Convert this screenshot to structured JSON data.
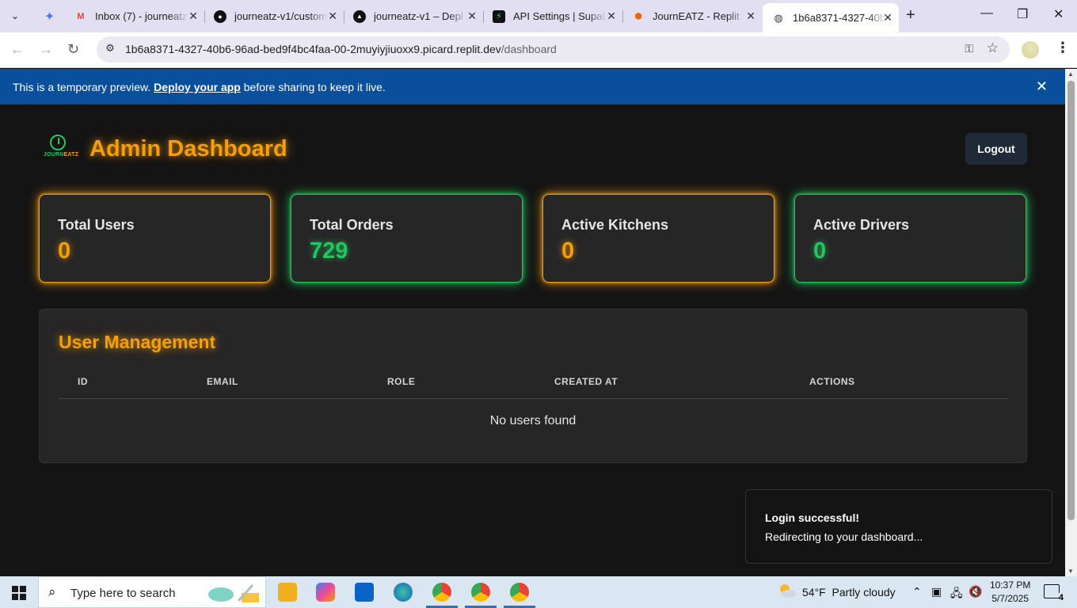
{
  "browser": {
    "tabs": [
      {
        "title": "Inbox (7) - journeatz",
        "favicon": "gmail-icon",
        "active": false
      },
      {
        "title": "journeatz-v1/custom",
        "favicon": "github-icon",
        "active": false
      },
      {
        "title": "journeatz-v1 – Depl",
        "favicon": "vercel-icon",
        "active": false
      },
      {
        "title": "API Settings | Supab",
        "favicon": "supabase-icon",
        "active": false
      },
      {
        "title": "JournEATZ - Replit",
        "favicon": "replit-icon",
        "active": false
      },
      {
        "title": "1b6a8371-4327-40b",
        "favicon": "globe-icon",
        "active": true
      }
    ],
    "url_host": "1b6a8371-4327-40b6-96ad-bed9f4bc4faa-00-2muyiyjiuoxx9.picard.replit.dev",
    "url_path": "/dashboard"
  },
  "banner": {
    "prefix": "This is a temporary preview. ",
    "link": "Deploy your app",
    "suffix": " before sharing to keep it live."
  },
  "app": {
    "logo_word_a": "JOURN",
    "logo_word_b": "EATZ",
    "title": "Admin Dashboard",
    "logout_label": "Logout",
    "stats": [
      {
        "label": "Total Users",
        "value": "0",
        "color": "#f59e0b"
      },
      {
        "label": "Total Orders",
        "value": "729",
        "color": "#22c55e"
      },
      {
        "label": "Active Kitchens",
        "value": "0",
        "color": "#f59e0b"
      },
      {
        "label": "Active Drivers",
        "value": "0",
        "color": "#22c55e"
      }
    ],
    "user_management": {
      "title": "User Management",
      "columns": [
        "ID",
        "EMAIL",
        "ROLE",
        "CREATED AT",
        "ACTIONS"
      ],
      "empty_text": "No users found"
    },
    "toast": {
      "title": "Login successful!",
      "message": "Redirecting to your dashboard..."
    }
  },
  "taskbar": {
    "search_placeholder": "Type here to search",
    "weather_temp": "54°F",
    "weather_desc": "Partly cloudy",
    "time": "10:37 PM",
    "date": "5/7/2025",
    "notification_count": "4"
  }
}
